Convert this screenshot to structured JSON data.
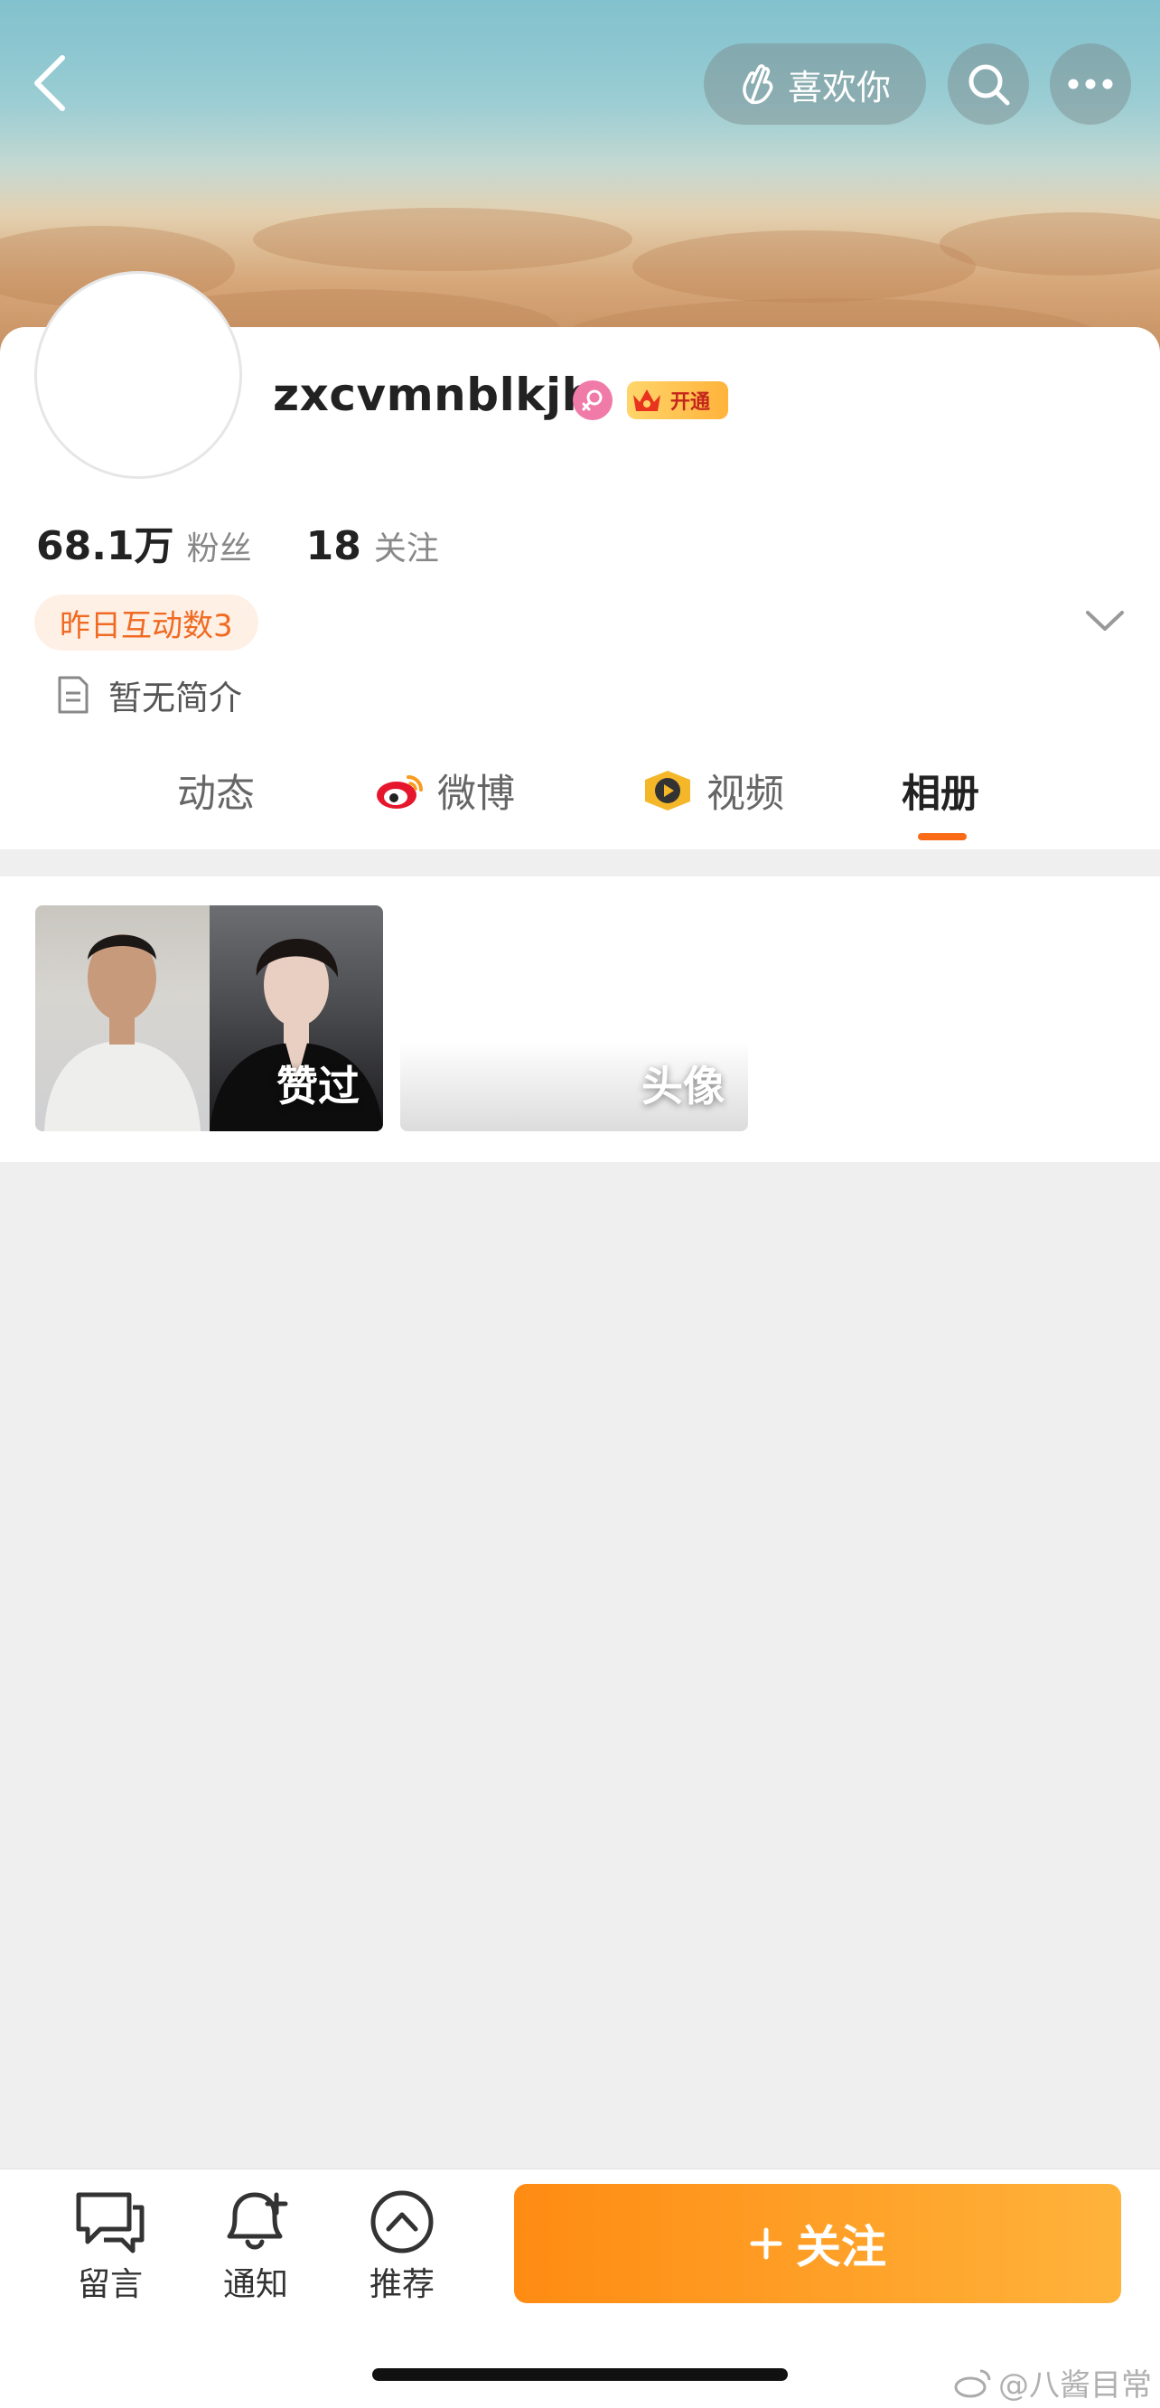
{
  "header": {
    "like_label": "喜欢你"
  },
  "profile": {
    "username": "zxcvmnblkjh",
    "vip_label": "开通",
    "followers_count": "68.1万",
    "followers_label": "粉丝",
    "following_count": "18",
    "following_label": "关注",
    "interaction_tag": "昨日互动数3",
    "bio": "暂无简介"
  },
  "tabs": [
    {
      "label": "动态",
      "icon": "none",
      "active": false
    },
    {
      "label": "微博",
      "icon": "weibo-icon",
      "active": false
    },
    {
      "label": "视频",
      "icon": "video-icon",
      "active": false
    },
    {
      "label": "相册",
      "icon": "none",
      "active": true
    }
  ],
  "albums": [
    {
      "label": "赞过"
    },
    {
      "label": "头像"
    }
  ],
  "bottom_bar": {
    "message_label": "留言",
    "notify_label": "通知",
    "recommend_label": "推荐",
    "follow_label": "关注"
  },
  "watermark": "@八酱目常",
  "colors": {
    "accent": "#f96b16",
    "follow_gradient_start": "#ff8b12",
    "follow_gradient_end": "#ffb33b",
    "tag_bg": "#fff0e6",
    "tag_text": "#f06a22",
    "page_bg": "#efefef"
  }
}
